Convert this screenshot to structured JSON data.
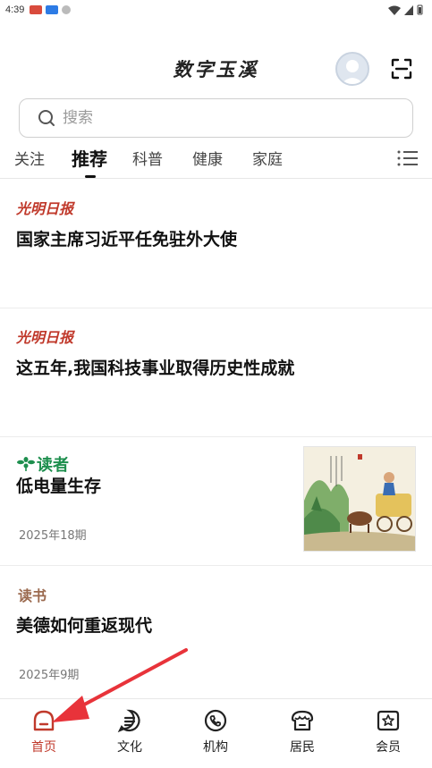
{
  "status_bar": {
    "time": "4:39"
  },
  "header": {
    "app_title": "数字玉溪"
  },
  "search": {
    "placeholder": "搜索"
  },
  "tabs": [
    {
      "label": "关注",
      "active": false
    },
    {
      "label": "推荐",
      "active": true
    },
    {
      "label": "科普",
      "active": false
    },
    {
      "label": "健康",
      "active": false
    },
    {
      "label": "家庭",
      "active": false
    }
  ],
  "feed": [
    {
      "source": "光明日报",
      "title": "国家主席习近平任免驻外大使"
    },
    {
      "source": "光明日报",
      "title": "这五年,我国科技事业取得历史性成就"
    },
    {
      "source": "读者",
      "title": "低电量生存",
      "issue": "2025年18期"
    },
    {
      "source": "读书",
      "title": "美德如何重返现代",
      "issue": "2025年9期"
    }
  ],
  "bottom_nav": [
    {
      "label": "首页",
      "icon": "home-icon",
      "active": true
    },
    {
      "label": "文化",
      "icon": "culture-icon",
      "active": false
    },
    {
      "label": "机构",
      "icon": "phone-icon",
      "active": false
    },
    {
      "label": "居民",
      "icon": "residents-icon",
      "active": false
    },
    {
      "label": "会员",
      "icon": "member-star-icon",
      "active": false
    }
  ],
  "colors": {
    "accent": "#c0392b",
    "duzhe_green": "#1e8f4e",
    "dushu_brown": "#9b6a4f",
    "annotation_arrow": "#e8333a"
  }
}
